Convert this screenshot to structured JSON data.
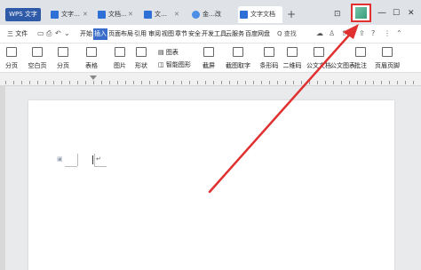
{
  "title_bar": {
    "app_tab": "WPS 文字",
    "tabs": [
      {
        "label": "文字…",
        "icon": "doc-icon"
      },
      {
        "label": "文档…",
        "icon": "doc-icon"
      },
      {
        "label": "文…",
        "icon": "doc-icon"
      },
      {
        "label": "金…改",
        "icon": "web-icon"
      },
      {
        "label": "文字文档",
        "icon": "doc-icon",
        "active": true
      }
    ],
    "new_tab": "+",
    "layout_icon": "⊡",
    "minimize": "—",
    "maximize": "☐",
    "close": "✕"
  },
  "menu": {
    "file": "三 文件",
    "tabs": [
      "开始",
      "插入",
      "页面布局",
      "引用",
      "审阅",
      "视图",
      "章节",
      "安全",
      "开发工具",
      "云服务",
      "百度网盘"
    ],
    "selected": "插入",
    "search": "Q 查找"
  },
  "ribbon": {
    "items": [
      {
        "label": "分页",
        "name": "page-break"
      },
      {
        "label": "空白页",
        "name": "blank-page"
      },
      {
        "label": "分页",
        "name": "pagination"
      },
      {
        "label": "表格",
        "name": "table"
      },
      {
        "label": "图片",
        "name": "picture"
      },
      {
        "label": "形状",
        "name": "shape"
      },
      {
        "label": "图表",
        "name": "chart"
      },
      {
        "label": "智能图形",
        "name": "smart-graphic"
      },
      {
        "label": "截屏",
        "name": "screenshot"
      },
      {
        "label": "截图取字",
        "name": "screenshot-text"
      },
      {
        "label": "条形码",
        "name": "barcode"
      },
      {
        "label": "二维码",
        "name": "qrcode"
      },
      {
        "label": "公文文档",
        "name": "official-doc"
      },
      {
        "label": "公文图表",
        "name": "official-chart"
      },
      {
        "label": "批注",
        "name": "comment"
      },
      {
        "label": "页眉页脚",
        "name": "header-footer"
      }
    ]
  },
  "document": {
    "paragraph_mark": "↵"
  },
  "colors": {
    "accent": "#3a6dc9",
    "highlight_box": "#e03030",
    "arrow": "#e03030"
  }
}
